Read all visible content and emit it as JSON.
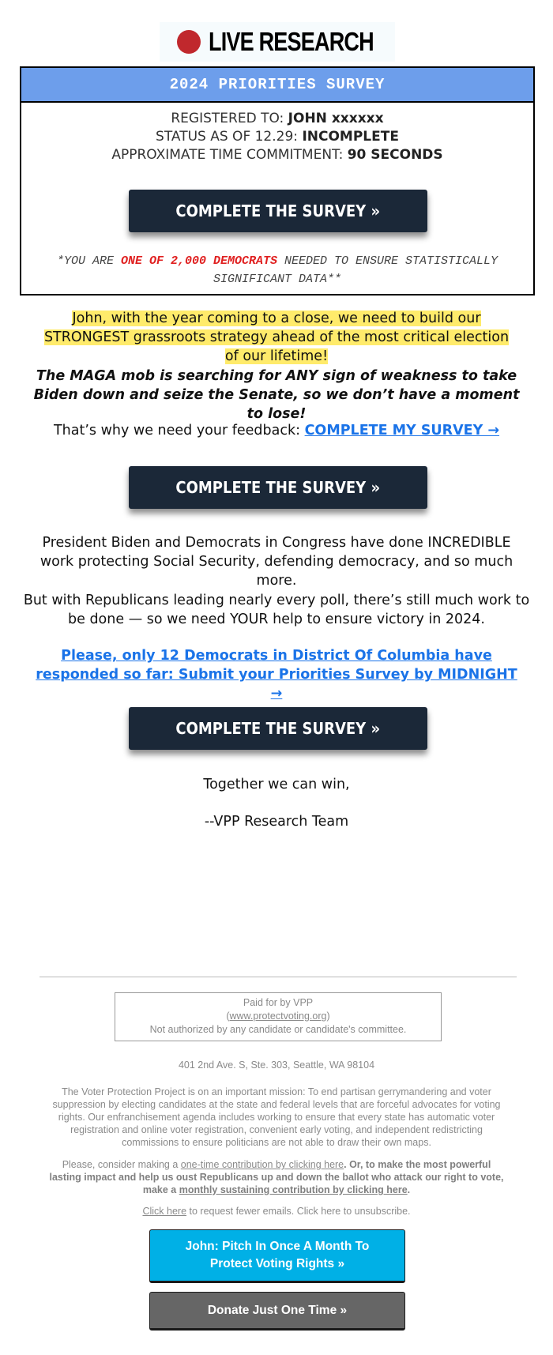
{
  "logo": {
    "icon": "red-record-dot",
    "text": "LIVE RESEARCH"
  },
  "survey_box": {
    "title": "2024 PRIORITIES SURVEY",
    "registered_label": "REGISTERED TO:",
    "registered_value": "JOHN xxxxxx",
    "status_label": "STATUS AS OF 12.29:",
    "status_value": "INCOMPLETE",
    "time_label": "APPROXIMATE TIME COMMITMENT:",
    "time_value": "90 SECONDS",
    "button_label": "COMPLETE THE SURVEY »",
    "footnote_prefix": "*YOU ARE ",
    "footnote_highlight": "ONE OF 2,000 DEMOCRATS",
    "footnote_suffix": " NEEDED TO ENSURE STATISTICALLY SIGNIFICANT DATA**"
  },
  "body": {
    "intro_highlighted": "John, with the year coming to a close, we need to build our STRONGEST grassroots strategy ahead of the most critical election of our lifetime!",
    "maga_warning": "The MAGA mob is searching for ANY sign of weakness to take Biden down and seize the Senate, so we don’t have a moment to lose!",
    "feedback_text": "That’s why we need your feedback: ",
    "feedback_link": "COMPLETE MY SURVEY →",
    "button_2_label": "COMPLETE THE SURVEY »",
    "biden_paragraph": "President Biden and Democrats in Congress have done INCREDIBLE work protecting Social Security, defending democracy, and so much more.",
    "republicans_paragraph": "But with Republicans leading nearly every poll, there’s still much work to be done — so we need YOUR help to ensure victory in 2024.",
    "deadline_link": "Please, only 12 Democrats in District Of Columbia have responded so far: Submit your Priorities Survey by MIDNIGHT →",
    "button_3_label": "COMPLETE THE SURVEY »",
    "signoff": "Together we can win,",
    "signature": "--VPP Research Team"
  },
  "footer": {
    "paid_for": "Paid for by VPP",
    "website_open": "(",
    "website": "www.protectvoting.org",
    "website_close": ")",
    "not_authorized": "Not authorized by any candidate or candidate's committee.",
    "address": "401 2nd Ave. S, Ste. 303, Seattle, WA 98104",
    "mission": "The Voter Protection Project is on an important mission: To end partisan gerrymandering and voter suppression by electing candidates at the state and federal levels that are forceful advocates for voting rights. Our enfranchisement agenda includes working to ensure that every state has automatic voter registration and online voter registration, convenient early voting, and independent redistricting commissions to ensure politicians are not able to draw their own maps.",
    "contrib_prefix": "Please, consider making a ",
    "contrib_link_1": "one-time contribution by clicking here",
    "contrib_mid": ". Or, to make the most powerful lasting impact and help us oust Republicans up and down the ballot who attack our right to vote, make a ",
    "contrib_link_2": "monthly sustaining contribution by clicking here",
    "contrib_end": ".",
    "fewer_emails_link": "Click here",
    "fewer_emails_text": " to request fewer emails. Click here to unsubscribe.",
    "monthly_button": "John: Pitch In Once A Month To Protect Voting Rights »",
    "once_button": "Donate Just One Time »"
  },
  "colors": {
    "survey_header": "#6d9eeb",
    "survey_button": "#1b2838",
    "link_blue": "#1a73e8",
    "highlight_yellow": "#ffeb6b",
    "footnote_red": "#e02020",
    "monthly_button": "#00b0e6",
    "once_button": "#666666",
    "logo_dot": "#c0282d"
  }
}
